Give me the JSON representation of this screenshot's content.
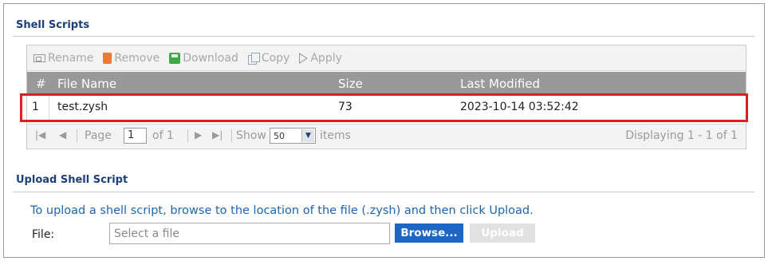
{
  "shell_scripts": {
    "title": "Shell Scripts",
    "toolbar": {
      "rename": "Rename",
      "remove": "Remove",
      "download": "Download",
      "copy": "Copy",
      "apply": "Apply"
    },
    "columns": [
      "#",
      "File Name",
      "Size",
      "Last Modified"
    ],
    "rows": [
      {
        "num": "1",
        "file_name": "test.zysh",
        "size": "73",
        "last_modified": "2023-10-14 03:52:42"
      }
    ],
    "pager": {
      "page_label": "Page",
      "page_value": "1",
      "of_label": "of 1",
      "show_label": "Show",
      "show_value": "50",
      "items_label": "items",
      "displaying": "Displaying 1 - 1 of 1"
    }
  },
  "upload": {
    "title": "Upload Shell Script",
    "instruction": "To upload a shell script, browse to the location of the file (.zysh) and then click Upload.",
    "file_label": "File:",
    "file_placeholder": "Select a file",
    "browse_label": "Browse...",
    "upload_label": "Upload"
  },
  "colors": {
    "section_title": "#1c3f7a",
    "header_bg": "#999999",
    "highlight": "#e31b23",
    "browse_bg": "#1f66c4",
    "instruction": "#1e66b0"
  }
}
